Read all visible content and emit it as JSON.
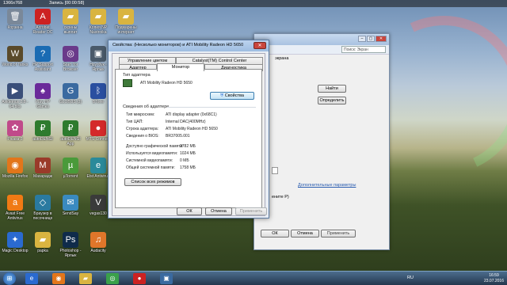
{
  "recorder": {
    "resolution": "1366x768",
    "status": "Запись [00:00:58]"
  },
  "desktop_icons": [
    {
      "label": "Корзина",
      "glyph": "🗑",
      "color": "#7a8899"
    },
    {
      "label": "World of Tanks",
      "glyph": "W",
      "color": "#5a4a2a"
    },
    {
      "label": "Avidemux 2.8 - 64 bits",
      "glyph": "▶",
      "color": "#3a4f7a"
    },
    {
      "label": "Picasa 3",
      "glyph": "✿",
      "color": "#c04a8a"
    },
    {
      "label": "Mozilla Firefox",
      "glyph": "◉",
      "color": "#e2761b"
    },
    {
      "label": "Avast Free Antivirus",
      "glyph": "a",
      "color": "#f07a14"
    },
    {
      "label": "Magic Desktop",
      "glyph": "✦",
      "color": "#2a6ad0"
    },
    {
      "label": "Acrobat Reader DC",
      "glyph": "A",
      "color": "#c22"
    },
    {
      "label": "HP Support Assistant",
      "glyph": "?",
      "color": "#1a6bb3"
    },
    {
      "label": "Play HP Games",
      "glyph": "♠",
      "color": "#6a2a9a"
    },
    {
      "label": "autoDENGI",
      "glyph": "₽",
      "color": "#2e7b2e"
    },
    {
      "label": "Махарадж",
      "glyph": "M",
      "color": "#9a3a2a"
    },
    {
      "label": "Браузер в песочнице",
      "glyph": "◇",
      "color": "#2a7aa0"
    },
    {
      "label": "papka",
      "glyph": "▰",
      "color": "#d9b440"
    },
    {
      "label": "скрины выплат",
      "glyph": "▰",
      "color": "#d9b440"
    },
    {
      "label": "Start Tor Browser",
      "glyph": "◎",
      "color": "#6a3a8a"
    },
    {
      "label": "GLOBUS (2)",
      "glyph": "G",
      "color": "#3a6aa0"
    },
    {
      "label": "autoDENGI App",
      "glyph": "₽",
      "color": "#2e7b2e"
    },
    {
      "label": "µTorrent",
      "glyph": "µ",
      "color": "#4a9a3a"
    },
    {
      "label": "SendSay",
      "glyph": "✉",
      "color": "#3a8ac0"
    },
    {
      "label": "Photoshop - Ярлык",
      "glyph": "Ps",
      "color": "#0f2b4a"
    },
    {
      "label": "Копия NP Nastroika",
      "glyph": "▰",
      "color": "#d9b440"
    },
    {
      "label": "Ноутбук - Ярлык",
      "glyph": "▣",
      "color": "#4a5a6a"
    },
    {
      "label": "BTone",
      "glyph": "ᛒ",
      "color": "#2a4fa0"
    },
    {
      "label": "MTS Connect",
      "glyph": "●",
      "color": "#d42a2a"
    },
    {
      "label": "Etst Antivirus",
      "glyph": "e",
      "color": "#2a8a9a"
    },
    {
      "label": "vegas130",
      "glyph": "V",
      "color": "#3a3a3a"
    },
    {
      "label": "Audacity",
      "glyph": "♫",
      "color": "#e0762a"
    },
    {
      "label": "Подмарены интернет",
      "glyph": "▰",
      "color": "#d9b440"
    }
  ],
  "bg_window": {
    "search_placeholder": "Поиск: Экран",
    "address_hint": "экрана",
    "find_button": "Найти",
    "detect_button": "Определить",
    "advanced_link": "Дополнительные параметры",
    "partial_text": "ените P)",
    "ok": "ОК",
    "cancel": "Отмена",
    "apply": "Применить"
  },
  "dialog": {
    "title": "Свойства: (Несколько мониторов) и ATI Mobility Radeon HD 5650",
    "close_glyph": "✕",
    "tabs_top": [
      "Управление цветом",
      "Catalyst(TM) Control Center"
    ],
    "tabs_bottom": [
      "Адаптер",
      "Монитор",
      "Диагностика"
    ],
    "adapter_type_label": "Тип адаптера",
    "adapter_name": "ATI Mobility Radeon HD 5650",
    "properties_button": "Свойства",
    "info_group_label": "Сведения об адаптере",
    "info_rows": [
      {
        "label": "Тип микросхем:",
        "value": "ATI display adapter (0x68C1)"
      },
      {
        "label": "Тип ЦАП:",
        "value": "Internal DAC(400MHz)"
      },
      {
        "label": "Строка адаптера:",
        "value": "ATI Mobility Radeon HD 5650"
      },
      {
        "label": "Сведения о BIOS:",
        "value": "BR37005.001"
      }
    ],
    "memory_rows": [
      {
        "label": "Доступно графической памяти:",
        "value": "2782 МБ"
      },
      {
        "label": "Используется видеопамяти:",
        "value": "1024 МБ"
      },
      {
        "label": "Системной видеопамяти:",
        "value": "0 МБ"
      },
      {
        "label": "Общей системной памяти:",
        "value": "1758 МБ"
      }
    ],
    "list_modes_button": "Список всех режимов",
    "ok": "ОК",
    "cancel": "Отмена",
    "apply": "Применить"
  },
  "taskbar": {
    "start_glyph": "⊞",
    "lang": "RU",
    "time": "16:59",
    "date": "23.07.2016",
    "pinned": [
      {
        "glyph": "e",
        "color": "#2a6ad0"
      },
      {
        "glyph": "◉",
        "color": "#e2761b"
      },
      {
        "glyph": "▰",
        "color": "#d9b440"
      },
      {
        "glyph": "◎",
        "color": "#3aa04a"
      },
      {
        "glyph": "●",
        "color": "#c22"
      },
      {
        "glyph": "▣",
        "color": "#3a6aa0"
      }
    ]
  }
}
